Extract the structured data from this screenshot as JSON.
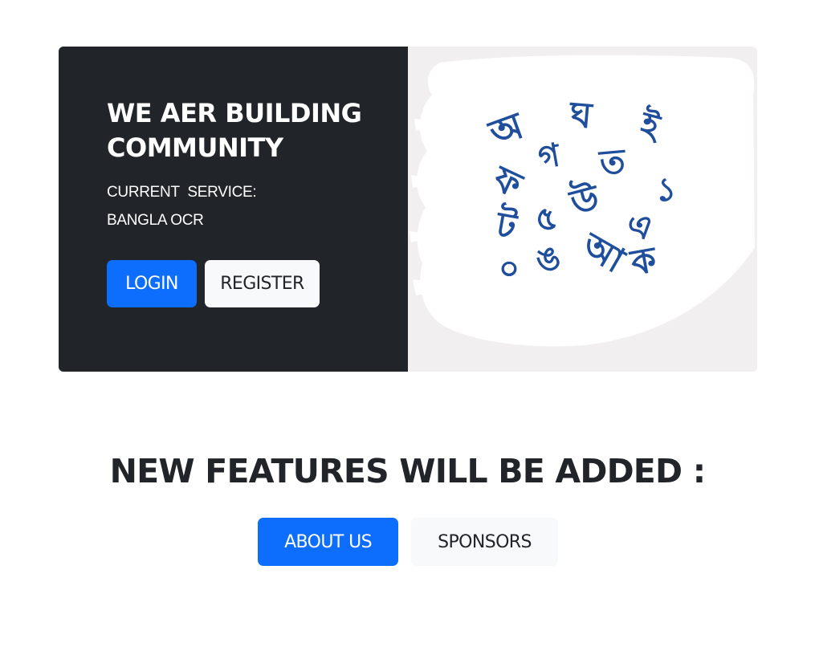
{
  "hero": {
    "title_line1": "WE AER BUILDING",
    "title_line2": "COMMUNITY",
    "service_label": "CURRENT  SERVICE:",
    "service_name": "BANGLA OCR",
    "login_label": "LOGIN",
    "register_label": "REGISTER",
    "letters": [
      "অ",
      "ঘ",
      "ই",
      "গ",
      "ফ",
      "ত",
      "১",
      "উ",
      "ট",
      "৫",
      "এ",
      "০",
      "ঙ",
      "আ",
      "ক"
    ],
    "letter_color": "#1f4e9c"
  },
  "features": {
    "title": "NEW FEATURES WILL BE ADDED :",
    "about_label": "ABOUT US",
    "sponsors_label": "SPONSORS"
  },
  "colors": {
    "dark": "#212529",
    "primary": "#0d6efd",
    "light": "#f8f9fa"
  }
}
